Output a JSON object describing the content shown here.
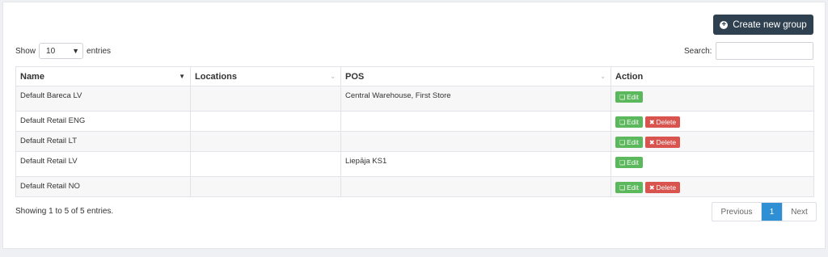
{
  "toolbar": {
    "create_label": "Create new group",
    "create_icon": "plus-circle-icon"
  },
  "length": {
    "show_label": "Show",
    "value": "10",
    "entries_label": "entries"
  },
  "search": {
    "label": "Search:",
    "value": ""
  },
  "table": {
    "headers": [
      "Name",
      "Locations",
      "POS",
      "Action"
    ],
    "rows": [
      {
        "name": "Default Bareca LV",
        "locations": "",
        "pos": "Central Warehouse, First Store",
        "actions": [
          "Edit"
        ]
      },
      {
        "name": "Default Retail ENG",
        "locations": "",
        "pos": "",
        "actions": [
          "Edit",
          "Delete"
        ]
      },
      {
        "name": "Default Retail LT",
        "locations": "",
        "pos": "",
        "actions": [
          "Edit",
          "Delete"
        ]
      },
      {
        "name": "Default Retail LV",
        "locations": "",
        "pos": "Liepāja KS1",
        "actions": [
          "Edit"
        ]
      },
      {
        "name": "Default Retail NO",
        "locations": "",
        "pos": "",
        "actions": [
          "Edit",
          "Delete"
        ]
      }
    ],
    "edit_label": "Edit",
    "delete_label": "Delete"
  },
  "info": "Showing 1 to 5 of 5 entries.",
  "pagination": {
    "previous": "Previous",
    "current": "1",
    "next": "Next"
  },
  "colors": {
    "primary": "#2f4050",
    "edit": "#5cb85c",
    "delete": "#d9534f",
    "page_active": "#2f8fd5"
  }
}
